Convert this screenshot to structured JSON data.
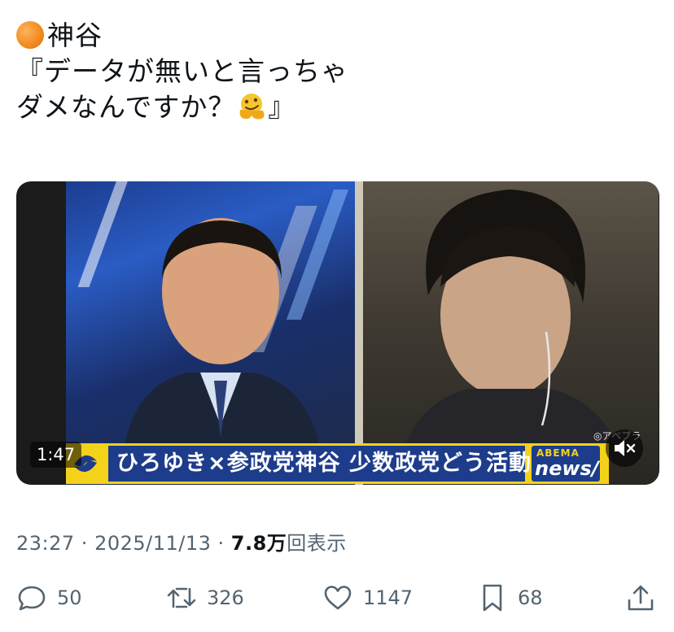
{
  "post": {
    "author_name": "神谷",
    "text_line1": "『データが無いと言っちゃ",
    "text_line2": "ダメなんですか？",
    "text_line2_end": "』"
  },
  "video": {
    "duration": "1:47",
    "caption": "ひろゆき×参政党神谷 少数政党どう活動?",
    "brand_top": "ABEMA",
    "brand_bottom": "news/",
    "watermark": "◎アベプラ"
  },
  "meta": {
    "time": "23:27",
    "separator1": " · ",
    "date": "2025/11/13",
    "separator2": " · ",
    "views_count": "7.8万",
    "views_label": "回表示"
  },
  "actions": {
    "replies": "50",
    "reposts": "326",
    "likes": "1147",
    "bookmarks": "68"
  },
  "colors": {
    "text": "#0f1419",
    "muted": "#536471",
    "caption_bg": "#1d3c8c",
    "caption_band": "#f5d21a"
  },
  "icons": [
    "orange-circle-icon",
    "melting-face-icon",
    "mute-icon",
    "reply-icon",
    "repost-icon",
    "like-icon",
    "bookmark-icon",
    "share-icon"
  ]
}
